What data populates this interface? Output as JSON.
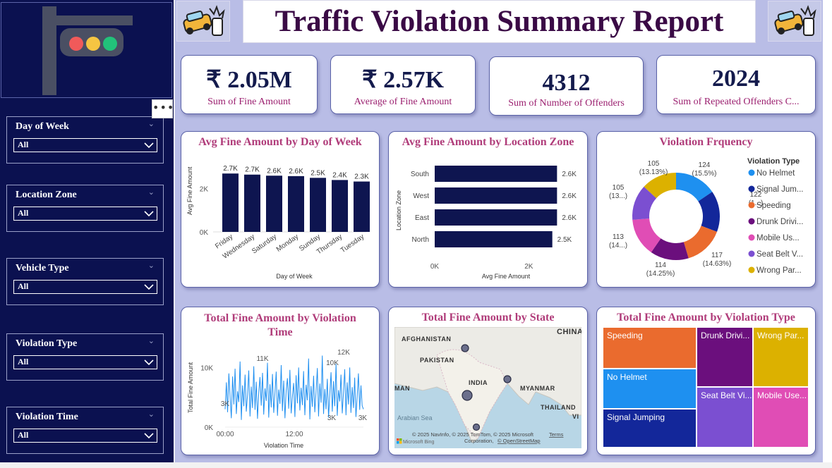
{
  "header": {
    "title": "Traffic Violation Summary Report",
    "icon_left": "car-crash-icon",
    "icon_right": "car-crash-icon"
  },
  "sidebar": {
    "logo_icon": "traffic-light-icon",
    "more_label": "•••",
    "slicers": [
      {
        "label": "Day of Week",
        "value": "All"
      },
      {
        "label": "Location Zone",
        "value": "All"
      },
      {
        "label": "Vehicle Type",
        "value": "All"
      },
      {
        "label": "Violation Type",
        "value": "All"
      },
      {
        "label": "Violation Time",
        "value": "All"
      }
    ]
  },
  "kpis": [
    {
      "value": "₹ 2.05M",
      "caption": "Sum of Fine Amount"
    },
    {
      "value": "₹ 2.57K",
      "caption": "Average of Fine Amount"
    },
    {
      "value": "4312",
      "caption": "Sum of Number of Offenders"
    },
    {
      "value": "2024",
      "caption": "Sum of Repeated Offenders C..."
    }
  ],
  "chart_titles": {
    "day": "Avg Fine Amount by Day of Week",
    "zone": "Avg Fine Amount by Location Zone",
    "freq": "Violation Frquency",
    "time_line1": "Total Fine Amount by Violation",
    "time_line2": "Time",
    "state": "Total Fine Amount by State",
    "treemap": "Total Fine Amount by Violation Type"
  },
  "colors": {
    "navy": "#0b1150",
    "bar": "#0e1550",
    "title": "#3a0a45",
    "accent": "#b03c7a",
    "line": "#1f8ff0"
  },
  "chart_data": [
    {
      "type": "bar",
      "title": "Avg Fine Amount by Day of Week",
      "xlabel": "Day of Week",
      "ylabel": "Avg Fine Amount",
      "categories": [
        "Friday",
        "Wednesday",
        "Saturday",
        "Monday",
        "Sunday",
        "Thursday",
        "Tuesday"
      ],
      "values": [
        2700,
        2650,
        2600,
        2580,
        2500,
        2400,
        2330
      ],
      "data_labels": [
        "2.7K",
        "2.7K",
        "2.6K",
        "2.6K",
        "2.5K",
        "2.4K",
        "2.3K"
      ],
      "yticks": [
        "0K",
        "2K"
      ],
      "ylim": [
        0,
        3000
      ]
    },
    {
      "type": "bar",
      "orientation": "horizontal",
      "title": "Avg Fine Amount by Location Zone",
      "xlabel": "Avg Fine Amount",
      "ylabel": "Location Zone",
      "categories": [
        "South",
        "West",
        "East",
        "North"
      ],
      "values": [
        2600,
        2600,
        2600,
        2500
      ],
      "data_labels": [
        "2.6K",
        "2.6K",
        "2.6K",
        "2.5K"
      ],
      "xticks": [
        "0K",
        "2K"
      ],
      "xlim": [
        0,
        3000
      ]
    },
    {
      "type": "pie",
      "subtype": "donut",
      "title": "Violation Frquency",
      "legend_title": "Violation Type",
      "legend_position": "right",
      "categories": [
        "No Helmet",
        "Signal Jum...",
        "Speeding",
        "Drunk Drivi...",
        "Mobile Us...",
        "Seat Belt V...",
        "Wrong Par..."
      ],
      "values": [
        124,
        122,
        117,
        114,
        113,
        105,
        105
      ],
      "colors": [
        "#1e90f0",
        "#13279a",
        "#ea6b2e",
        "#6b0f7d",
        "#e04db5",
        "#7b4fd1",
        "#dcb100"
      ],
      "labels": [
        {
          "line1": "124",
          "line2": "(15.5%)"
        },
        {
          "line1": "122",
          "line2": "(1...)"
        },
        {
          "line1": "117",
          "line2": "(14.63%)"
        },
        {
          "line1": "114",
          "line2": "(14.25%)"
        },
        {
          "line1": "113",
          "line2": "(14...)"
        },
        {
          "line1": "105",
          "line2": "(13...)"
        },
        {
          "line1": "105",
          "line2": "(13.13%)"
        }
      ]
    },
    {
      "type": "line",
      "title": "Total Fine Amount by Violation Time",
      "xlabel": "Violation Time",
      "ylabel": "Total Fine Amount",
      "xticks": [
        "00:00",
        "12:00"
      ],
      "yticks": [
        "0K",
        "10K"
      ],
      "ylim": [
        0,
        13000
      ],
      "annotations": [
        "11K",
        "12K",
        "10K",
        "3K",
        "3K",
        "3K"
      ],
      "values": [
        3000,
        7500,
        2500,
        9000,
        5000,
        1500,
        8500,
        3800,
        9800,
        2200,
        6000,
        4200,
        11000,
        1200,
        7000,
        3500,
        8800,
        2600,
        5400,
        9500,
        1800,
        6800,
        3200,
        10200,
        2900,
        7600,
        1400,
        5800,
        8400,
        3600,
        9100,
        2100,
        6500,
        4400,
        10800,
        1600,
        7200,
        3300,
        8900,
        2400,
        5600,
        9300,
        1900,
        6300,
        3900,
        10400,
        2700,
        7800,
        1500,
        6100,
        8200,
        3100,
        9600,
        2300,
        5200,
        7400,
        1700,
        8700,
        4000,
        10000,
        2800,
        6600,
        3700,
        9400,
        2000,
        7100,
        4500,
        11500,
        1300,
        6900,
        3400,
        8600,
        2500,
        5900,
        9900,
        1800,
        7300,
        4100,
        12000,
        2200,
        6400,
        3000,
        8100,
        1600,
        5500,
        9200,
        2600,
        7700,
        3500,
        10600,
        1900,
        6200,
        4300,
        8800,
        2300,
        5700,
        9700,
        2000,
        7500,
        3800,
        10000,
        2400,
        6700,
        3200,
        8300,
        1700,
        5300,
        9000,
        2900,
        7000,
        3600,
        3000
      ]
    },
    {
      "type": "scatter",
      "subtype": "map",
      "title": "Total Fine Amount by State",
      "map_labels": [
        "CHINA",
        "AFGHANISTAN",
        "PAKISTAN",
        "INDIA",
        "MYANMAR",
        "THAILAND",
        "MAN",
        "Arabian Sea",
        "VI"
      ],
      "attribution": "© 2025 NavInfo, © 2025 TomTom, © 2025 Microsoft",
      "attribution2": "Corporation,",
      "terms": "Terms",
      "osm": "© OpenStreetMap",
      "brand": "Microsoft Bing"
    },
    {
      "type": "heatmap",
      "subtype": "treemap",
      "title": "Total Fine Amount by Violation Type",
      "categories": [
        "Speeding",
        "No Helmet",
        "Signal Jumping",
        "Drunk Drivi...",
        "Seat Belt Vi...",
        "Wrong Par...",
        "Mobile Use..."
      ],
      "colors": [
        "#ea6b2e",
        "#1e90f0",
        "#13279a",
        "#6b0f7d",
        "#7b4fd1",
        "#dcb100",
        "#e04db5"
      ]
    }
  ]
}
